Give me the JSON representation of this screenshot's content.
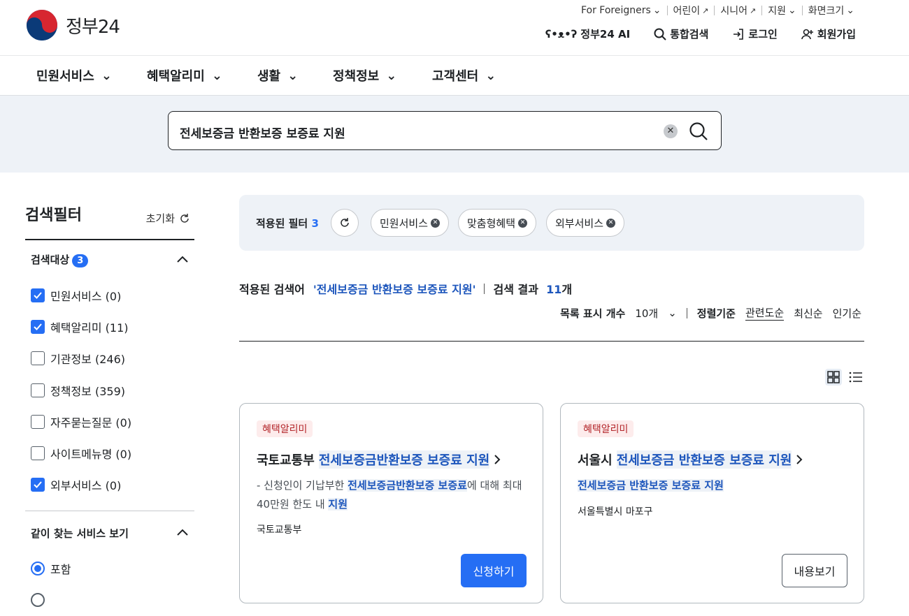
{
  "header": {
    "logo_text": "정부24",
    "util_links": [
      {
        "label": "For Foreigners",
        "icon": "chevron-down-icon"
      },
      {
        "label": "어린이",
        "icon": "external-link-icon"
      },
      {
        "label": "시니어",
        "icon": "external-link-icon"
      },
      {
        "label": "지원",
        "icon": "chevron-down-icon"
      },
      {
        "label": "화면크기",
        "icon": "chevron-down-icon"
      }
    ],
    "gnb_top": [
      {
        "label": "정부24 AI",
        "icon": "ai-bear-icon"
      },
      {
        "label": "통합검색",
        "icon": "search-icon"
      },
      {
        "label": "로그인",
        "icon": "login-icon"
      },
      {
        "label": "회원가입",
        "icon": "user-plus-icon"
      }
    ]
  },
  "nav": {
    "items": [
      "민원서비스",
      "혜택알리미",
      "생활",
      "정책정보",
      "고객센터"
    ]
  },
  "search": {
    "value": "전세보증금 반환보증 보증료 지원",
    "clear_icon": "✕"
  },
  "sidebar": {
    "title": "검색필터",
    "reset_label": "초기화",
    "target_section": {
      "label": "검색대상",
      "count": "3",
      "items": [
        {
          "label": "민원서비스 (0)",
          "checked": true
        },
        {
          "label": "혜택알리미 (11)",
          "checked": true
        },
        {
          "label": "기관정보 (246)",
          "checked": false
        },
        {
          "label": "정책정보 (359)",
          "checked": false
        },
        {
          "label": "자주묻는질문 (0)",
          "checked": false
        },
        {
          "label": "사이트메뉴명 (0)",
          "checked": false
        },
        {
          "label": "외부서비스 (0)",
          "checked": true
        }
      ]
    },
    "related_section": {
      "label": "같이 찾는 서비스 보기",
      "options": [
        {
          "label": "포함",
          "selected": true
        }
      ]
    }
  },
  "filters": {
    "label": "적용된 필터",
    "count": "3",
    "chips": [
      "민원서비스",
      "맞춤형혜택",
      "외부서비스"
    ]
  },
  "results": {
    "applied_label": "적용된 검색어",
    "query": "'전세보증금 반환보증 보증료 지원'",
    "count_label": "검색 결과",
    "count_num": "11",
    "count_unit": "개",
    "per_page_label": "목록 표시 개수",
    "per_page_value": "10개",
    "sort_label": "정렬기준",
    "sort_options": [
      "관련도순",
      "최신순",
      "인기순"
    ],
    "active_sort": "관련도순"
  },
  "cards": [
    {
      "tag": "혜택알리미",
      "title_prefix": "국토교통부",
      "title_highlight": "전세보증금반환보증 보증료 지원",
      "desc_plain1": "- 신청인이 기납부한 ",
      "desc_hl1": "전세보증금반환보증 보증료",
      "desc_plain2": "에 대해 최대 40만원 한도 내 ",
      "desc_hl2": "지원",
      "org": "국토교통부",
      "button": "신청하기"
    },
    {
      "tag": "혜택알리미",
      "title_prefix": "서울시",
      "title_highlight": "전세보증금 반환보증 보증료 지원",
      "desc_hl": "전세보증금 반환보증 보증료 지원",
      "org": "서울특별시 마포구",
      "button": "내용보기"
    }
  ],
  "colors": {
    "accent": "#256ef4",
    "highlight_text": "#1d56bc",
    "band_bg": "#eef2f7",
    "tag_bg": "#fdecec",
    "tag_text": "#b3262a"
  }
}
